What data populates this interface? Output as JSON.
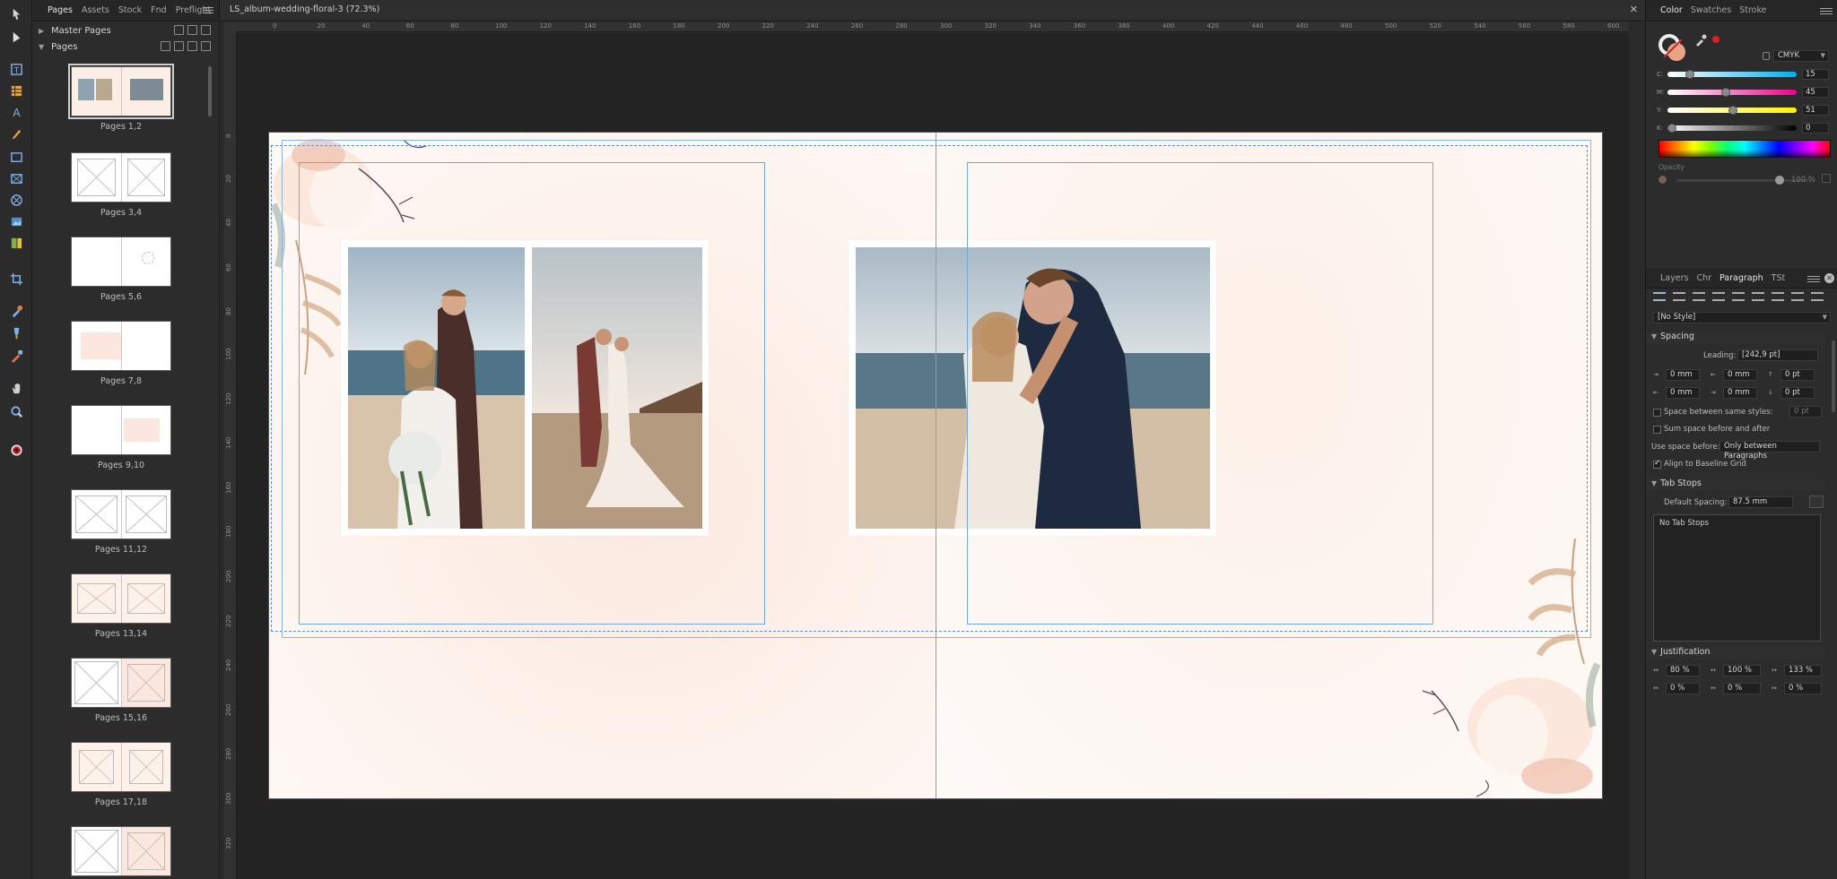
{
  "pages_panel": {
    "tabs": [
      "Pages",
      "Assets",
      "Stock",
      "Fnd",
      "Preflight"
    ],
    "active_tab": "Pages",
    "master_pages_label": "Master Pages",
    "pages_label": "Pages",
    "thumbs": [
      {
        "label": "Pages 1,2"
      },
      {
        "label": "Pages 3,4"
      },
      {
        "label": "Pages 5,6"
      },
      {
        "label": "Pages 7,8"
      },
      {
        "label": "Pages 9,10"
      },
      {
        "label": "Pages 11,12"
      },
      {
        "label": "Pages 13,14"
      },
      {
        "label": "Pages 15,16"
      },
      {
        "label": "Pages 17,18"
      },
      {
        "label": ""
      }
    ]
  },
  "document": {
    "tab_title": "LS_album-wedding-floral-3 (72.3%)",
    "ruler_unit": "mm",
    "ruler_h_ticks": [
      "0",
      "20",
      "40",
      "60",
      "80",
      "100",
      "120",
      "140",
      "160",
      "180",
      "200",
      "220",
      "240",
      "260",
      "280",
      "300",
      "320",
      "340",
      "360",
      "380",
      "400",
      "420",
      "440",
      "460",
      "480",
      "500",
      "520",
      "540",
      "560",
      "580",
      "600"
    ],
    "ruler_v_ticks": [
      "0",
      "20",
      "40",
      "60",
      "80",
      "100",
      "120",
      "140",
      "160",
      "180",
      "200",
      "220",
      "240",
      "260",
      "280",
      "300",
      "320"
    ]
  },
  "color_panel": {
    "tabs": [
      "Color",
      "Swatches",
      "Stroke"
    ],
    "active_tab": "Color",
    "model": "CMYK",
    "channels": [
      {
        "name": "C:",
        "value": "15",
        "level": 0.15,
        "gradient": "linear-gradient(90deg,#ffffff,#00aeef)"
      },
      {
        "name": "M:",
        "value": "45",
        "level": 0.45,
        "gradient": "linear-gradient(90deg,#ffffff,#ec008c)"
      },
      {
        "name": "Y:",
        "value": "51",
        "level": 0.51,
        "gradient": "linear-gradient(90deg,#ffffff,#fff200)"
      },
      {
        "name": "K:",
        "value": "0",
        "level": 0.0,
        "gradient": "linear-gradient(90deg,#ffffff,#000000)"
      }
    ],
    "opacity_label": "Opacity",
    "opacity_value": "100 %"
  },
  "paragraph_panel": {
    "tabs": [
      "Layers",
      "Chr",
      "Paragraph",
      "TSt"
    ],
    "active_tab": "Paragraph",
    "style": "[No Style]",
    "spacing_title": "Spacing",
    "leading_label": "Leading:",
    "leading_value": "[242,9 pt]",
    "indent_left": "0 mm",
    "indent_first": "0 mm",
    "space_before": "0 pt",
    "indent_right": "0 mm",
    "indent_last": "0 mm",
    "space_after": "0 pt",
    "space_between_label": "Space between same styles:",
    "space_between_value": "0 pt",
    "sum_space_label": "Sum space before and after",
    "use_space_before_label": "Use space before:",
    "use_space_before_value": "Only between Paragraphs",
    "align_baseline_label": "Align to Baseline Grid",
    "tab_stops_title": "Tab Stops",
    "default_spacing_label": "Default Spacing:",
    "default_spacing_value": "87.5 mm",
    "no_tab_stops": "No Tab Stops",
    "justification_title": "Justification",
    "word_min": "80 %",
    "word_desired": "100 %",
    "word_max": "133 %",
    "letter_min": "0 %",
    "letter_desired": "0 %",
    "letter_max": "0 %"
  }
}
